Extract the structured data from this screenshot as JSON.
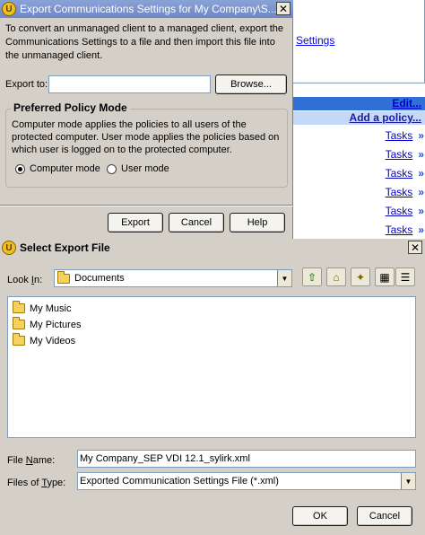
{
  "background_console": {
    "settings_link": "Settings",
    "edit_link": "Edit...",
    "add_policy_link": "Add a policy...",
    "tasks": [
      "Tasks",
      "Tasks",
      "Tasks",
      "Tasks",
      "Tasks",
      "Tasks"
    ],
    "task_arrow": "»"
  },
  "export_dialog": {
    "title": "Export Communications Settings for My Company\\S...",
    "close_glyph": "✕",
    "description": "To convert an unmanaged client to a managed client, export the Communications Settings to a file and then import this file into the unmanaged client.",
    "export_to_label": "Export to:",
    "export_to_value": "",
    "browse_label": "Browse...",
    "policy_group_title": "Preferred Policy Mode",
    "policy_description": "Computer mode applies the policies to all users of the protected computer. User mode applies the policies based on which user is logged on to the protected computer.",
    "radio_computer_label": "Computer mode",
    "radio_user_label": "User mode",
    "selected_mode": "Computer mode",
    "export_label": "Export",
    "cancel_label": "Cancel",
    "help_label": "Help"
  },
  "file_dialog": {
    "title": "Select Export File",
    "close_glyph": "✕",
    "look_in_prefix": "Look ",
    "look_in_key": "I",
    "look_in_suffix": "n:",
    "look_in_value": "Documents",
    "toolbar_icons": [
      "up-folder-icon",
      "home-icon",
      "new-folder-icon",
      "list-view-icon",
      "details-view-icon"
    ],
    "files": [
      {
        "name": "My Music",
        "icon": "folder-icon"
      },
      {
        "name": "My Pictures",
        "icon": "folder-icon"
      },
      {
        "name": "My Videos",
        "icon": "folder-icon"
      }
    ],
    "file_name_prefix": "File ",
    "file_name_key": "N",
    "file_name_suffix": "ame:",
    "file_name_value": "My Company_SEP VDI 12.1_sylirk.xml",
    "files_type_prefix": "Files of ",
    "files_type_key": "T",
    "files_type_suffix": "ype:",
    "files_type_value": "Exported Communication Settings File (*.xml)",
    "ok_label": "OK",
    "cancel_label": "Cancel"
  }
}
